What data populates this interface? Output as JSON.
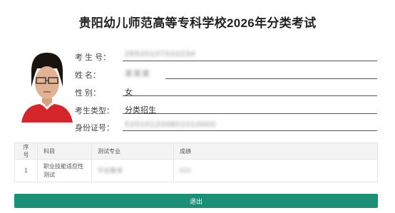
{
  "page": {
    "title": "贵阳幼儿师范高等专科学校2026年分类考试"
  },
  "candidate": {
    "fields": [
      {
        "label": "考 生 号：",
        "value": "",
        "blurred_placeholder": "26520107010234"
      },
      {
        "label": "姓    名：",
        "value": "",
        "blurred_placeholder": "某某某"
      },
      {
        "label": "性    别：",
        "value": "女"
      },
      {
        "label": "考生类型：",
        "value": "分类招生"
      },
      {
        "label": "身份证号：",
        "value": "",
        "blurred_placeholder": "520101200801010000"
      }
    ]
  },
  "table": {
    "headers": [
      "序号",
      "科目",
      "测试专业",
      "成绩"
    ],
    "rows": [
      {
        "index": "1",
        "subject": "职业技能适应性测试",
        "major": "",
        "score": "",
        "major_blur": "学前教育",
        "score_blur": "000"
      }
    ]
  },
  "actions": {
    "exit_label": "退出"
  },
  "colors": {
    "accent": "#1b8f76",
    "table_header_bg": "#f4f4f4"
  }
}
